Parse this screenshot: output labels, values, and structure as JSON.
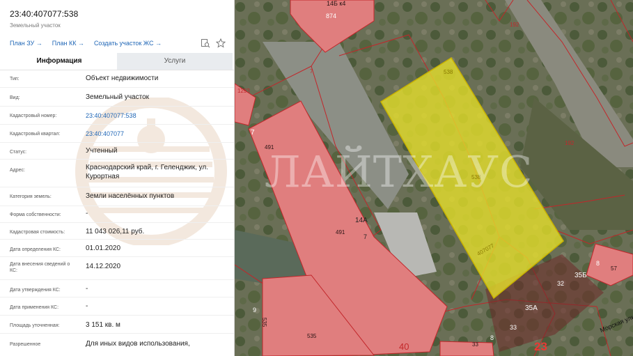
{
  "parcel": {
    "cadastral_number": "23:40:407077:538",
    "subtitle": "Земельный участок"
  },
  "links": {
    "plan_zu": "План ЗУ →",
    "plan_kk": "План КК →",
    "create_zhs": "Создать участок ЖС →"
  },
  "tabs": {
    "info": "Информация",
    "services": "Услуги"
  },
  "rows": [
    {
      "label": "Тип:",
      "value": "Объект недвижимости"
    },
    {
      "label": "Вид:",
      "value": "Земельный участок"
    },
    {
      "label": "Кадастровый номер:",
      "value": "23:40:407077:538"
    },
    {
      "label": "Кадастровый квартал:",
      "value": "23:40:407077"
    },
    {
      "label": "Статус:",
      "value": "Учтенный"
    },
    {
      "label": "Адрес:",
      "value": "Краснодарский край, г. Геленджик, ул. Курортная"
    },
    {
      "label": "Категория земель:",
      "value": "Земли населённых пунктов"
    },
    {
      "label": "Форма собственности:",
      "value": "-"
    },
    {
      "label": "Кадастровая стоимость:",
      "value": "11 043 026,11 руб."
    },
    {
      "label": "Дата определения КС:",
      "value": "01.01.2020"
    },
    {
      "label": "Дата внесения сведений о КС:",
      "value": "14.12.2020"
    },
    {
      "label": "Дата утверждения КС:",
      "value": "-"
    },
    {
      "label": "Дата применения КС:",
      "value": "-"
    },
    {
      "label": "Площадь уточненная:",
      "value": "3 151 кв. м"
    },
    {
      "label": "Разрешенное",
      "value": "Для иных видов использования,"
    }
  ],
  "map": {
    "labels": {
      "l14b": "14Б к4",
      "l874": "874",
      "l192a": "192",
      "l7a": "7",
      "l1293": "1293",
      "l7b": "7",
      "l491a": "491",
      "l538a": "538",
      "l538b": "538",
      "l192b": "192",
      "l14a": "14А",
      "l491b": "491",
      "l7c": "7",
      "l407077": "407077",
      "l8": "8",
      "l57": "57",
      "l35b": "35Б",
      "l32": "32",
      "l9": "9",
      "l535a": "535",
      "l535b": "535",
      "l35a": "35А",
      "l33a": "33",
      "l8b": "8",
      "l40": "40",
      "l33b": "33",
      "l23": "23",
      "street": "Морская ули"
    },
    "watermark": "ЛАЙТХАУС",
    "colors": {
      "building": "#e07e7e",
      "selected_parcel": "#e8e22a",
      "boundary": "#c2262a"
    }
  }
}
